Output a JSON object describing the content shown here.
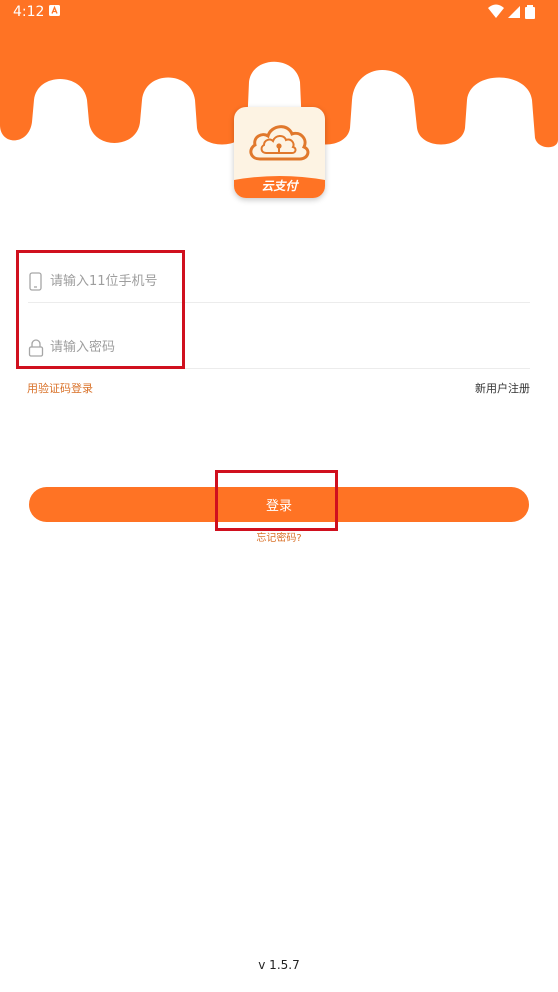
{
  "status_bar": {
    "time": "4:12",
    "icons": [
      "notification-a-icon",
      "wifi-icon",
      "cell-signal-icon",
      "battery-icon"
    ]
  },
  "colors": {
    "brand_orange": "#ff7324",
    "link_orange": "#d9722a",
    "logo_cream": "#fdf3e3",
    "annotation_red": "#d0101e"
  },
  "logo": {
    "banner_text": "云支付",
    "icon": "cloud-lock-icon"
  },
  "form": {
    "phone": {
      "placeholder": "请输入11位手机号",
      "value": "",
      "icon": "phone-icon"
    },
    "password": {
      "placeholder": "请输入密码",
      "value": "",
      "icon": "lock-icon"
    }
  },
  "links": {
    "sms_login": "用验证码登录",
    "register": "新用户注册",
    "forgot_password": "忘记密码?"
  },
  "login_button": {
    "label": "登录"
  },
  "footer": {
    "version": "v 1.5.7"
  }
}
